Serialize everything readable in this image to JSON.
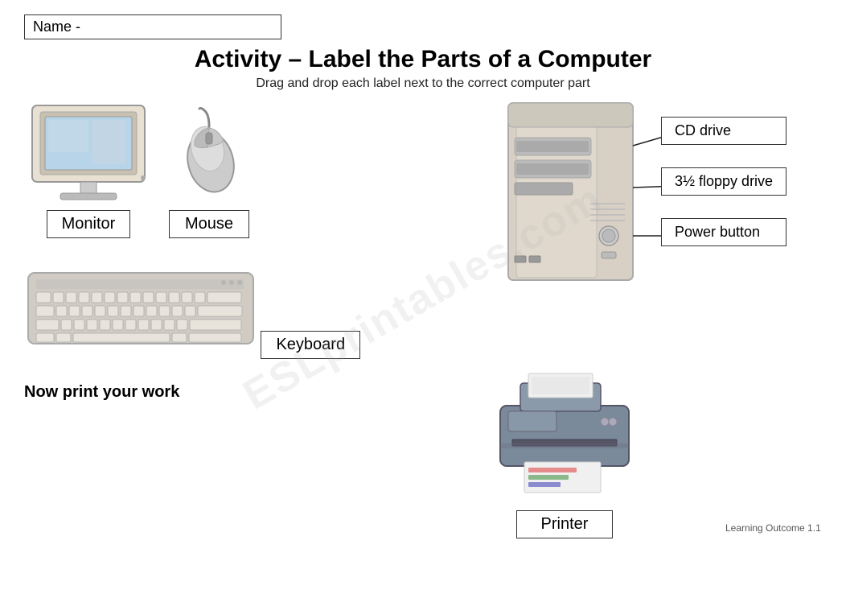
{
  "name_label": "Name -",
  "title": "Activity – Label the Parts of a Computer",
  "subtitle": "Drag and drop each label next to the correct computer part",
  "labels": {
    "monitor": "Monitor",
    "mouse": "Mouse",
    "keyboard": "Keyboard",
    "printer": "Printer",
    "cd_drive": "CD drive",
    "floppy_drive": "3½ floppy drive",
    "power_button": "Power button"
  },
  "footer": {
    "now_print": "Now print your work",
    "learning_outcome": "Learning Outcome 1.1"
  },
  "watermark": "ESLprintables.com"
}
